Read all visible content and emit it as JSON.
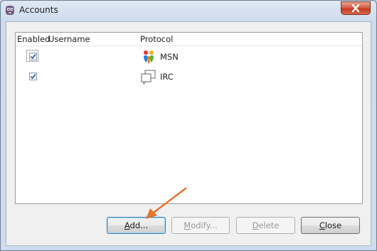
{
  "window": {
    "title": "Accounts",
    "app_icon": "pidgin-icon",
    "close_icon": "close-icon"
  },
  "list": {
    "columns": [
      "Enabled",
      "Username",
      "Protocol"
    ],
    "rows": [
      {
        "enabled": true,
        "username": "",
        "protocol": "MSN",
        "icon": "msn-icon"
      },
      {
        "enabled": true,
        "username": "",
        "protocol": "IRC",
        "icon": "irc-icon"
      }
    ]
  },
  "buttons": {
    "add": {
      "mnemonic": "A",
      "rest": "dd..."
    },
    "modify": {
      "mnemonic": "M",
      "rest": "odify..."
    },
    "delete": {
      "mnemonic": "D",
      "rest": "elete"
    },
    "close": {
      "mnemonic": "C",
      "rest": "lose"
    }
  },
  "colors": {
    "annotation_arrow": "#e8732a",
    "focus_border": "#3c7fb1"
  }
}
